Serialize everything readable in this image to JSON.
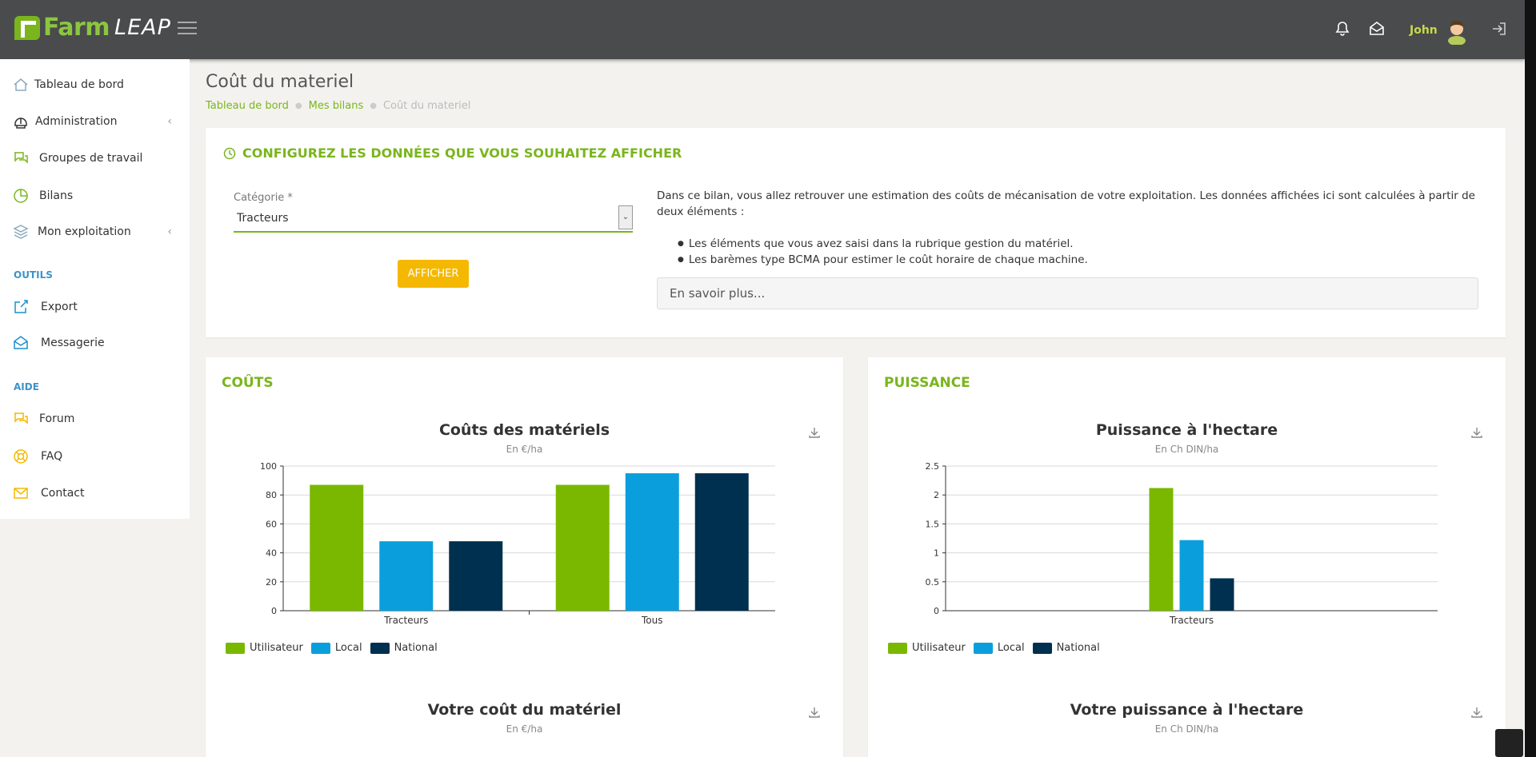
{
  "header": {
    "logo_farm": "Farm",
    "logo_leap": "LEAP",
    "user_name": "John"
  },
  "sidebar": {
    "items": [
      {
        "label": "Tableau de bord",
        "icon": "home-icon"
      },
      {
        "label": "Administration",
        "icon": "helmet-icon"
      },
      {
        "label": "Groupes de travail",
        "icon": "chat-icon"
      },
      {
        "label": "Bilans",
        "icon": "pie-chart-icon"
      },
      {
        "label": "Mon exploitation",
        "icon": "layers-icon"
      }
    ],
    "section_tools": "OUTILS",
    "tools": [
      {
        "label": "Export",
        "icon": "export-icon"
      },
      {
        "label": "Messagerie",
        "icon": "mail-open-icon"
      }
    ],
    "section_help": "AIDE",
    "help": [
      {
        "label": "Forum",
        "icon": "chat-icon"
      },
      {
        "label": "FAQ",
        "icon": "lifebuoy-icon"
      },
      {
        "label": "Contact",
        "icon": "envelope-icon"
      }
    ]
  },
  "page": {
    "title": "Coût du materiel",
    "breadcrumb": [
      "Tableau de bord",
      "Mes bilans",
      "Coût du materiel"
    ]
  },
  "config": {
    "title": "CONFIGUREZ LES DONNÉES QUE VOUS SOUHAITEZ AFFICHER",
    "category_label": "Catégorie *",
    "category_value": "Tracteurs",
    "button": "AFFICHER",
    "info_text": "Dans ce bilan, vous allez retrouver une estimation des coûts de mécanisation de votre exploitation. Les données affichées ici sont calculées à partir de deux éléments :",
    "bullets": [
      "Les éléments que vous avez saisi dans la rubrique gestion du matériel.",
      "Les barèmes type BCMA pour estimer le coût horaire de chaque machine."
    ],
    "learn_more": "En savoir plus..."
  },
  "colors": {
    "utilisateur": "#7ab800",
    "local": "#0a9fdc",
    "national": "#00304f",
    "brand_green": "#7ab51d"
  },
  "cards": {
    "costs": {
      "section": "COÛTS",
      "chart_title": "Coûts des matériels",
      "chart_subtitle": "En €/ha",
      "chart2_title": "Votre coût du matériel",
      "chart2_subtitle": "En €/ha"
    },
    "power": {
      "section": "PUISSANCE",
      "chart_title": "Puissance à l'hectare",
      "chart_subtitle": "En Ch DIN/ha",
      "chart2_title": "Votre puissance à l'hectare",
      "chart2_subtitle": "En Ch DIN/ha"
    }
  },
  "chart_data": [
    {
      "type": "bar",
      "title": "Coûts des matériels",
      "subtitle": "En €/ha",
      "categories": [
        "Tracteurs",
        "Tous"
      ],
      "ylim": [
        0,
        100
      ],
      "yticks": [
        0,
        20,
        40,
        60,
        80,
        100
      ],
      "series": [
        {
          "name": "Utilisateur",
          "values": [
            87,
            87
          ]
        },
        {
          "name": "Local",
          "values": [
            48,
            95
          ]
        },
        {
          "name": "National",
          "values": [
            48,
            95
          ]
        }
      ],
      "legend": "bottom-left",
      "grid": true
    },
    {
      "type": "bar",
      "title": "Puissance à l'hectare",
      "subtitle": "En Ch DIN/ha",
      "categories": [
        "Tracteurs"
      ],
      "ylim": [
        0,
        2.5
      ],
      "yticks": [
        0,
        0.5,
        1,
        1.5,
        2,
        2.5
      ],
      "series": [
        {
          "name": "Utilisateur",
          "values": [
            2.12
          ]
        },
        {
          "name": "Local",
          "values": [
            1.22
          ]
        },
        {
          "name": "National",
          "values": [
            0.56
          ]
        }
      ],
      "legend": "bottom-left",
      "grid": true
    }
  ]
}
